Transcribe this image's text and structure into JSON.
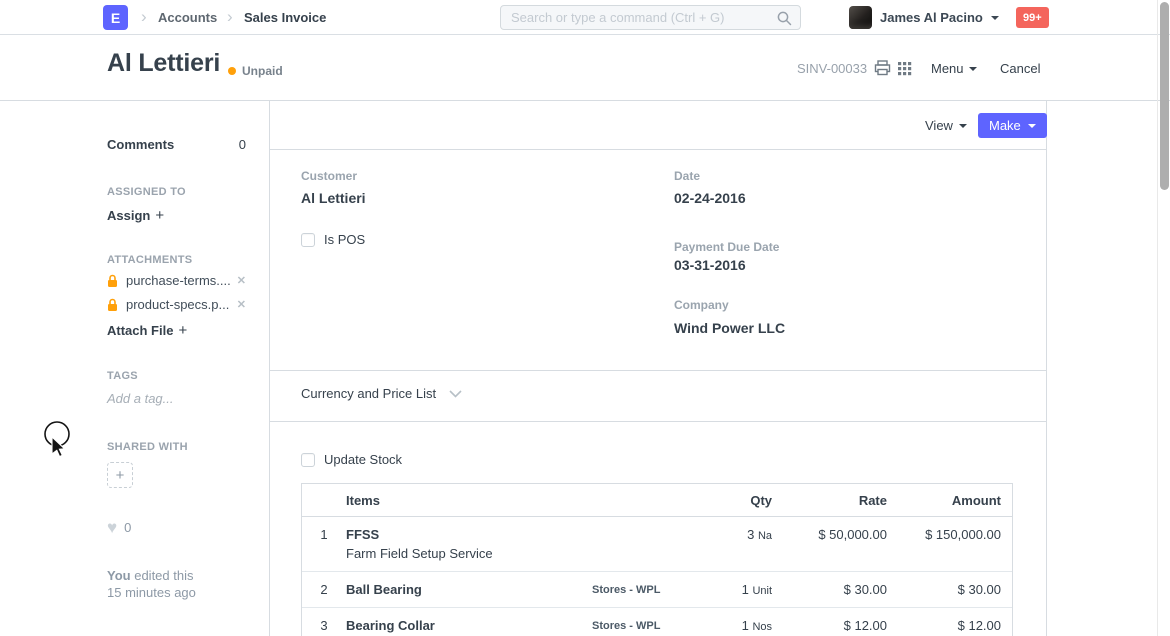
{
  "navbar": {
    "logo_letter": "E",
    "breadcrumbs": [
      "Accounts",
      "Sales Invoice"
    ],
    "search_placeholder": "Search or type a command (Ctrl + G)",
    "user_name": "James Al Pacino",
    "notification_count": "99+"
  },
  "page_header": {
    "title": "Al Lettieri",
    "status": "Unpaid",
    "doc_id": "SINV-00033",
    "menu_label": "Menu",
    "cancel_label": "Cancel"
  },
  "sidebar": {
    "comments_label": "Comments",
    "comments_count": "0",
    "assigned_to_label": "ASSIGNED TO",
    "assign_label": "Assign",
    "attachments_label": "ATTACHMENTS",
    "attachments": [
      {
        "name": "purchase-terms...."
      },
      {
        "name": "product-specs.p..."
      }
    ],
    "attach_file_label": "Attach File",
    "tags_label": "TAGS",
    "add_tag_placeholder": "Add a tag...",
    "shared_with_label": "SHARED WITH",
    "likes_count": "0",
    "edited_by": "You",
    "edited_action": "edited this",
    "edited_time": "15 minutes ago"
  },
  "toolbar": {
    "view_label": "View",
    "make_label": "Make"
  },
  "form": {
    "customer_label": "Customer",
    "customer_value": "Al Lettieri",
    "is_pos_label": "Is POS",
    "date_label": "Date",
    "date_value": "02-24-2016",
    "payment_due_date_label": "Payment Due Date",
    "payment_due_date_value": "03-31-2016",
    "company_label": "Company",
    "company_value": "Wind Power LLC",
    "currency_section_label": "Currency and Price List",
    "update_stock_label": "Update Stock"
  },
  "items_table": {
    "headers": {
      "items": "Items",
      "qty": "Qty",
      "rate": "Rate",
      "amount": "Amount"
    },
    "rows": [
      {
        "idx": "1",
        "item": "FFSS",
        "description": "Farm Field Setup Service",
        "warehouse": "",
        "qty": "3",
        "uom": "Na",
        "rate": "$ 50,000.00",
        "amount": "$ 150,000.00"
      },
      {
        "idx": "2",
        "item": "Ball Bearing",
        "description": "",
        "warehouse": "Stores - WPL",
        "qty": "1",
        "uom": "Unit",
        "rate": "$ 30.00",
        "amount": "$ 30.00"
      },
      {
        "idx": "3",
        "item": "Bearing Collar",
        "description": "",
        "warehouse": "Stores - WPL",
        "qty": "1",
        "uom": "Nos",
        "rate": "$ 12.00",
        "amount": "$ 12.00"
      }
    ]
  },
  "colors": {
    "accent": "#5e64ff",
    "status_unpaid": "#ffa00a",
    "notification_badge": "#f4655c",
    "text_dark": "#36414c",
    "text_muted": "#8d99a6",
    "border": "#d7dce1"
  }
}
